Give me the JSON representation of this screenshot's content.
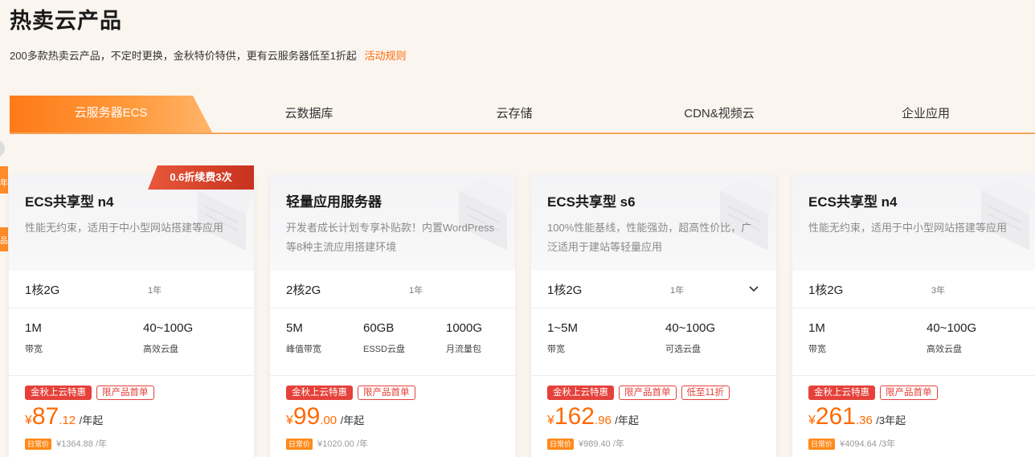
{
  "header": {
    "title": "热卖云产品",
    "subtitle": "200多款热卖云产品，不定时更换，金秋特价特供，更有云服务器低至1折起",
    "rules_link": "活动规则"
  },
  "tabs": [
    "云服务器ECS",
    "云数据库",
    "云存储",
    "CDN&视频云",
    "企业应用"
  ],
  "side_tabs": [
    "年",
    "品"
  ],
  "cards": [
    {
      "badge": "0.6折续费3次",
      "title": "ECS共享型 n4",
      "desc": "性能无约束，适用于中小型网站搭建等应用",
      "spec": "1核2G",
      "term": "1年",
      "attrs": [
        {
          "value": "1M",
          "label": "带宽"
        },
        {
          "value": "40~100G",
          "label": "高效云盘"
        }
      ],
      "tags": [
        "金秋上云特惠",
        "限产品首单"
      ],
      "price": {
        "currency": "¥",
        "int": "87",
        "dec": ".12",
        "unit": "/年起"
      },
      "daily_tag": "日常价",
      "original": "¥1364.88 /年"
    },
    {
      "badge": "",
      "title": "轻量应用服务器",
      "desc": "开发者成长计划专享补贴款！内置WordPress等8种主流应用搭建环境",
      "spec": "2核2G",
      "term": "1年",
      "attrs": [
        {
          "value": "5M",
          "label": "峰值带宽"
        },
        {
          "value": "60GB",
          "label": "ESSD云盘"
        },
        {
          "value": "1000G",
          "label": "月流量包"
        }
      ],
      "tags": [
        "金秋上云特惠",
        "限产品首单"
      ],
      "price": {
        "currency": "¥",
        "int": "99",
        "dec": ".00",
        "unit": "/年起"
      },
      "daily_tag": "日常价",
      "original": "¥1020.00 /年"
    },
    {
      "badge": "",
      "title": "ECS共享型 s6",
      "desc": "100%性能基线，性能强劲，超高性价比，广泛适用于建站等轻量应用",
      "spec": "1核2G",
      "term": "1年",
      "attrs": [
        {
          "value": "1~5M",
          "label": "带宽"
        },
        {
          "value": "40~100G",
          "label": "可选云盘"
        }
      ],
      "tags": [
        "金秋上云特惠",
        "限产品首单",
        "低至11折"
      ],
      "price": {
        "currency": "¥",
        "int": "162",
        "dec": ".96",
        "unit": "/年起"
      },
      "daily_tag": "日常价",
      "original": "¥989.40 /年"
    },
    {
      "badge": "",
      "title": "ECS共享型 n4",
      "desc": "性能无约束，适用于中小型网站搭建等应用",
      "spec": "1核2G",
      "term": "3年",
      "attrs": [
        {
          "value": "1M",
          "label": "带宽"
        },
        {
          "value": "40~100G",
          "label": "高效云盘"
        }
      ],
      "tags": [
        "金秋上云特惠",
        "限产品首单"
      ],
      "price": {
        "currency": "¥",
        "int": "261",
        "dec": ".36",
        "unit": "/3年起"
      },
      "daily_tag": "日常价",
      "original": "¥4094.64 /3年"
    }
  ],
  "colors": {
    "accent": "#ff6a00",
    "tag_red": "#e5413a",
    "badge_red": "#d8432c"
  }
}
